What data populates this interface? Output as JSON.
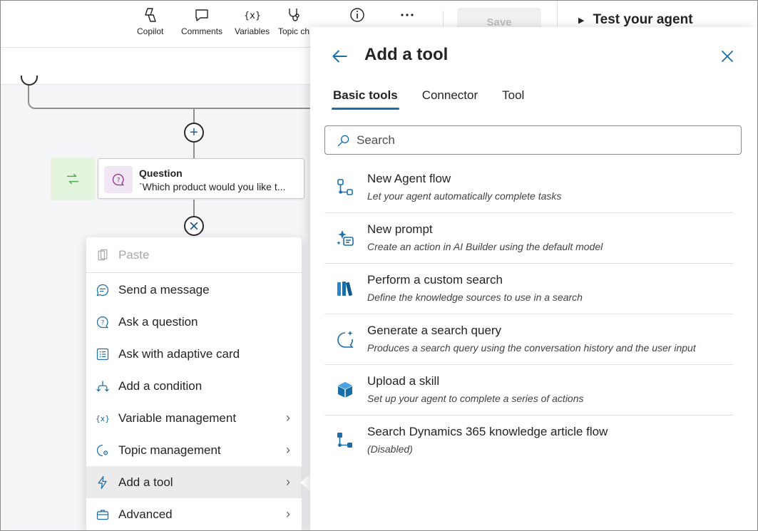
{
  "toolbar": {
    "copilot": "Copilot",
    "comments": "Comments",
    "variables": "Variables",
    "topic_checker": "Topic ch",
    "save": "Save"
  },
  "test_pane": {
    "title": "Test your agent"
  },
  "canvas": {
    "node": {
      "title": "Question",
      "subtitle": "`Which product would you like t..."
    }
  },
  "menu": {
    "items": [
      {
        "label": "Paste",
        "icon": "paste-icon",
        "disabled": true
      },
      {
        "label": "Send a message",
        "icon": "message-icon"
      },
      {
        "label": "Ask a question",
        "icon": "question-icon"
      },
      {
        "label": "Ask with adaptive card",
        "icon": "adaptive-card-icon"
      },
      {
        "label": "Add a condition",
        "icon": "condition-icon"
      },
      {
        "label": "Variable management",
        "icon": "variable-icon",
        "submenu": true
      },
      {
        "label": "Topic management",
        "icon": "topic-gear-icon",
        "submenu": true
      },
      {
        "label": "Add a tool",
        "icon": "tool-icon",
        "submenu": true,
        "active": true
      },
      {
        "label": "Advanced",
        "icon": "briefcase-icon",
        "submenu": true
      }
    ]
  },
  "panel": {
    "title": "Add a tool",
    "tabs": [
      "Basic tools",
      "Connector",
      "Tool"
    ],
    "active_tab": "Basic tools",
    "search_placeholder": "Search",
    "tools": [
      {
        "name": "New Agent flow",
        "desc": "Let your agent automatically complete tasks",
        "icon": "agent-flow-icon"
      },
      {
        "name": "New prompt",
        "desc": "Create an action in AI Builder using the default model",
        "icon": "prompt-sparkle-icon"
      },
      {
        "name": "Perform a custom search",
        "desc": "Define the knowledge sources to use in a search",
        "icon": "library-books-icon"
      },
      {
        "name": "Generate a search query",
        "desc": "Produces a search query using the conversation history and the user input",
        "icon": "chat-sparkle-icon"
      },
      {
        "name": "Upload a skill",
        "desc": "Set up your agent to complete a series of actions",
        "icon": "skill-cube-icon"
      },
      {
        "name": "Search Dynamics 365 knowledge article flow",
        "desc": "(Disabled)",
        "icon": "dynamics-flow-icon"
      }
    ]
  },
  "colors": {
    "accent": "#1b6ea8",
    "node_accent": "#e4f4de",
    "question_icon_bg": "#f1e6f4"
  }
}
